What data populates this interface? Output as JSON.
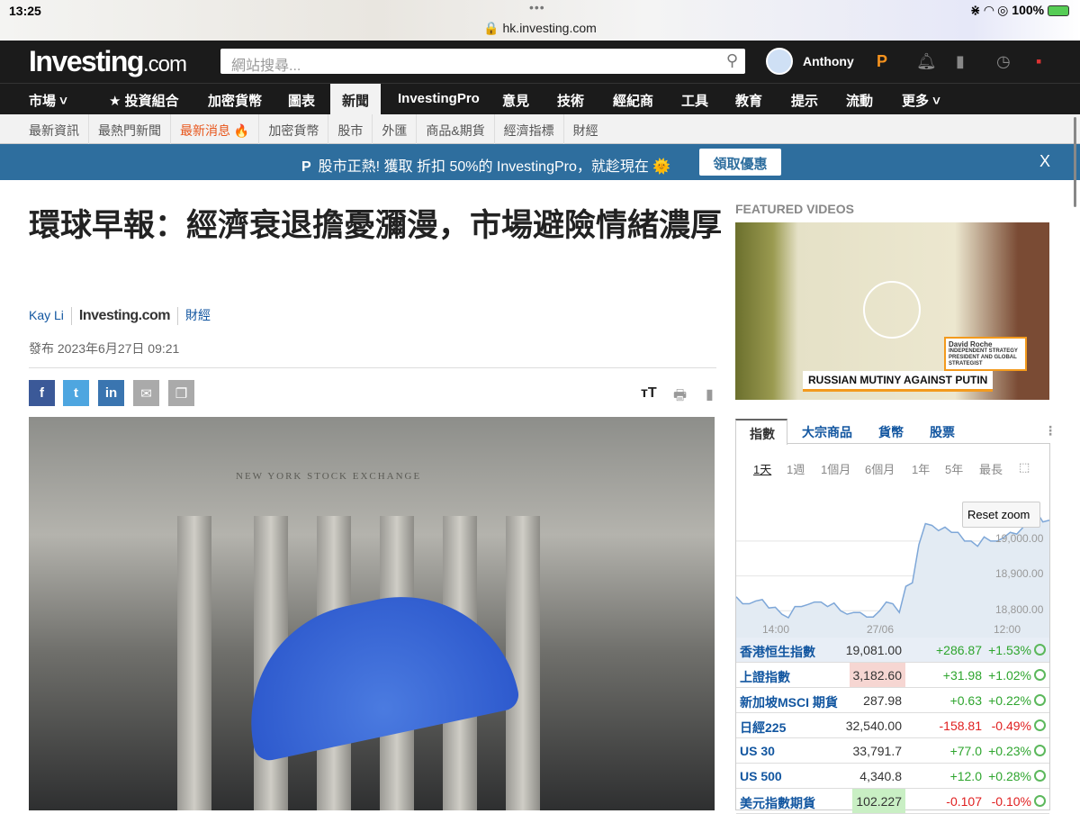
{
  "status": {
    "time": "13:25",
    "url": "hk.investing.com",
    "battery": "100%"
  },
  "header": {
    "logo_main": "Investing",
    "logo_suffix": ".com",
    "search_placeholder": "網站搜尋...",
    "user": "Anthony"
  },
  "nav": {
    "items": [
      "市場 ˅",
      "★ 投資組合",
      "加密貨幣",
      "圖表",
      "新聞",
      "InvestingPro",
      "意見",
      "技術",
      "經紀商",
      "工具",
      "教育",
      "提示",
      "流動",
      "更多 ˅"
    ]
  },
  "subnav": {
    "items": [
      "最新資訊",
      "最熱門新聞",
      "最新消息 🔥",
      "加密貨幣",
      "股市",
      "外匯",
      "商品&期貨",
      "經濟指標",
      "財經"
    ]
  },
  "banner": {
    "text": "股市正熱! 獲取 折扣 50%的 InvestingPro，就趁現在 🌞",
    "cta": "領取優惠",
    "close": "X"
  },
  "article": {
    "title": "環球早報：經濟衰退擔憂瀰漫，市場避險情緒濃厚",
    "author": "Kay Li",
    "source_logo": "Investing.com",
    "category": "財經",
    "date": "發布 2023年6月27日 09:21",
    "photo_sign": "NEW YORK STOCK EXCHANGE"
  },
  "share": [
    "f",
    "t",
    "in",
    "✉",
    "❐"
  ],
  "featured": {
    "heading": "FEATURED VIDEOS",
    "caption": "RUSSIAN MUTINY AGAINST PUTIN",
    "speaker": "David Roche",
    "speaker_title": "INDEPENDENT STRATEGY PRESIDENT AND GLOBAL STRATEGIST"
  },
  "widget": {
    "tabs": [
      "指數",
      "大宗商品",
      "貨幣",
      "股票"
    ],
    "periods": [
      "1天",
      "1週",
      "1個月",
      "6個月",
      "1年",
      "5年",
      "最長"
    ],
    "reset_zoom": "Reset zoom",
    "rows": [
      {
        "name": "香港恒生指數",
        "price": "19,081.00",
        "change": "+286.87",
        "pct": "+1.53%",
        "dir": "up",
        "flash": ""
      },
      {
        "name": "上證指數",
        "price": "3,182.60",
        "change": "+31.98",
        "pct": "+1.02%",
        "dir": "up",
        "flash": "#f6d6d2"
      },
      {
        "name": "新加坡MSCI 期貨",
        "price": "287.98",
        "change": "+0.63",
        "pct": "+0.22%",
        "dir": "up",
        "flash": ""
      },
      {
        "name": "日經225",
        "price": "32,540.00",
        "change": "-158.81",
        "pct": "-0.49%",
        "dir": "dn",
        "flash": ""
      },
      {
        "name": "US 30",
        "price": "33,791.7",
        "change": "+77.0",
        "pct": "+0.23%",
        "dir": "up",
        "flash": ""
      },
      {
        "name": "US 500",
        "price": "4,340.8",
        "change": "+12.0",
        "pct": "+0.28%",
        "dir": "up",
        "flash": ""
      },
      {
        "name": "美元指數期貨",
        "price": "102.227",
        "change": "-0.107",
        "pct": "-0.10%",
        "dir": "dn",
        "flash": "#c9efc4"
      }
    ]
  },
  "chart_data": {
    "type": "area",
    "title": "香港恒生指數",
    "x_ticks": [
      "14:00",
      "27/06",
      "12:00"
    ],
    "y_ticks": [
      "19,000.00",
      "18,900.00",
      "18,800.00"
    ],
    "ylim": [
      18780,
      19085
    ],
    "values": [
      18840,
      18820,
      18820,
      18828,
      18832,
      18808,
      18810,
      18790,
      18780,
      18812,
      18812,
      18818,
      18825,
      18825,
      18812,
      18822,
      18800,
      18790,
      18795,
      18795,
      18782,
      18782,
      18800,
      18825,
      18820,
      18795,
      18870,
      18880,
      18990,
      19050,
      19045,
      19030,
      19040,
      19025,
      19025,
      19000,
      19000,
      18985,
      19012,
      19000,
      19000,
      19010,
      19025,
      19020,
      19040,
      19050,
      19085,
      19055,
      19060
    ]
  }
}
